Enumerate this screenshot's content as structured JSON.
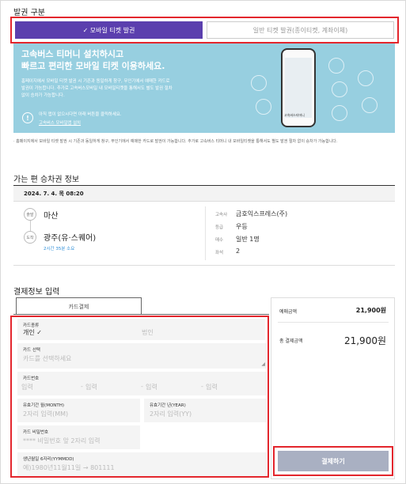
{
  "issue": {
    "section_title": "발권 구분",
    "mobile_tab": "✓ 모바일 티켓 발권",
    "paper_tab": "일반 티켓 발권(종이티켓, 계좌이체)"
  },
  "banner": {
    "headline_1": "고속버스 티머니 설치하시고",
    "headline_2": "빠르고 편리한 모바일 티켓 이용하세요.",
    "desc_1": "홈페이지에서 모바일 티켓 발권 시 기존과 동일하게 창구, 무인기에서 예매한 카드로",
    "desc_2": "발권이 가능합니다. 추가로 고속버스모바일 내 모바일티켓을 통해서도 별도 발권 절차",
    "desc_3": "없이 승차가 가능합니다.",
    "notice": "아직 앱이 없으시다면 아래 버튼을 클릭하세요.",
    "notice_link": "고속버스 모바일앱 설치",
    "phone_logo": "고속버스티머니"
  },
  "footnote": "· 홈페이지에서 모바일 티켓 발권 시 기존과 동일하게 창구, 무인기에서 예매한 카드로 발권이 가능합니다. 추가로 고속버스 티머니 내 모바일티켓을 통해서도 별도 발권 절차 없이 승차가 가능합니다.",
  "trip": {
    "section_title": "가는 편 승차권 정보",
    "date": "2024. 7. 4. 목 08:20",
    "depart_badge": "출발",
    "arrive_badge": "도착",
    "depart_city": "마산",
    "arrive_city": "광주(유·스퀘어)",
    "duration": "2시간 35분 소요",
    "company_label": "고속사",
    "company": "금호익스프레스(주)",
    "grade_label": "등급",
    "grade": "우등",
    "count_label": "매수",
    "count": "일반 1명",
    "seat_label": "좌석",
    "seat": "2"
  },
  "payment": {
    "section_title": "결제정보 입력",
    "tab_card": "카드결제",
    "card_type_label": "카드종류",
    "card_type_personal": "개인 ✓",
    "card_type_corp": "법인",
    "card_select_label": "카드 선택",
    "card_select_placeholder": "카드를 선택하세요",
    "card_number_label": "카드번호",
    "card_number_seg": "입력",
    "card_number_sep": "-",
    "expiry_month_label": "유효기간 월(MONTH)",
    "expiry_month_placeholder": "2자리 입력(MM)",
    "expiry_year_label": "유효기간 년(YEAR)",
    "expiry_year_placeholder": "2자리 입력(YY)",
    "pin_label": "카드 비밀번호",
    "pin_placeholder": "**** 비밀번호 앞 2자리 입력",
    "birth_label": "생년월일 6자리(YYMMDD)",
    "birth_placeholder": "예)1980년11월11일 → 801111"
  },
  "summary": {
    "booking_amount_label": "예매금액",
    "booking_amount": "21,900원",
    "total_label": "총 결제금액",
    "total_amount": "21,900원",
    "pay_button": "결제하기"
  },
  "colors": {
    "accent": "#5b3fae",
    "highlight": "#e3262d",
    "banner": "#97cfe0"
  }
}
